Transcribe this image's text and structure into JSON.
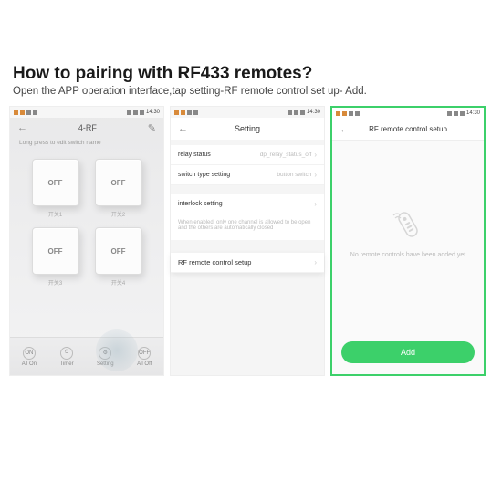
{
  "heading": {
    "title": "How to pairing with RF433 remotes?",
    "subtitle": "Open the APP operation interface,tap setting-RF remote control set up- Add."
  },
  "statusbar": {
    "time": "14:30"
  },
  "screen1": {
    "title": "4-RF",
    "hint": "Long press to edit switch name",
    "switches": [
      {
        "state": "OFF",
        "label": "开关1"
      },
      {
        "state": "OFF",
        "label": "开关2"
      },
      {
        "state": "OFF",
        "label": "开关3"
      },
      {
        "state": "OFF",
        "label": "开关4"
      }
    ],
    "toolbar": {
      "all_on": {
        "icon": "ON",
        "label": "All On"
      },
      "timer": {
        "icon": "⏱",
        "label": "Timer"
      },
      "setting": {
        "icon": "⚙",
        "label": "Setting"
      },
      "all_off": {
        "icon": "OFF",
        "label": "All Off"
      }
    }
  },
  "screen2": {
    "title": "Setting",
    "rows": {
      "relay_status": {
        "label": "relay status",
        "value": "dp_relay_status_off"
      },
      "switch_type": {
        "label": "switch type setting",
        "value": "button switch"
      },
      "interlock": {
        "label": "interlock setting",
        "desc": "When enabled, only one channel is allowed to be open and the others are automatically closed"
      },
      "rf_setup": {
        "label": "RF remote control setup"
      }
    }
  },
  "screen3": {
    "title": "RF remote control setup",
    "empty_text": "No remote controls have been added yet",
    "add_label": "Add"
  }
}
